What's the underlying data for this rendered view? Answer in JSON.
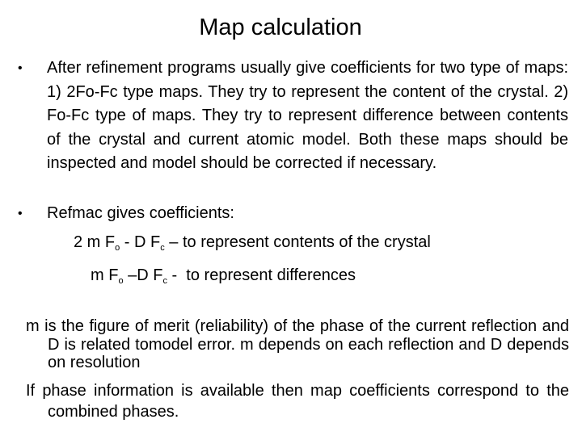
{
  "slide": {
    "title": "Map calculation",
    "bullets": [
      {
        "marker": "•",
        "text": "After refinement programs usually give coefficients for two type of maps: 1) 2Fo-Fc type maps. They try to represent the content of the crystal. 2) Fo-Fc type of maps. They try to represent difference between contents of the crystal and current atomic model. Both these maps should be inspected and model should be corrected if necessary."
      },
      {
        "marker": "•",
        "text": "Refmac gives coefficients:"
      }
    ],
    "formulas": [
      {
        "prefix": "2 m F",
        "sub1": "o",
        "mid": " - D F",
        "sub2": "c",
        "suffix": " – to represent contents of the crystal"
      },
      {
        "prefix": "m F",
        "sub1": "o",
        "mid": " –D F",
        "sub2": "c",
        "suffix": " -  to represent differences"
      }
    ],
    "notes": [
      "m is the figure of merit (reliability) of the phase of the current reflection and D is related tomodel error. m depends on each reflection and D depends on resolution",
      "If phase information is available then map coefficients correspond to the combined phases."
    ]
  }
}
